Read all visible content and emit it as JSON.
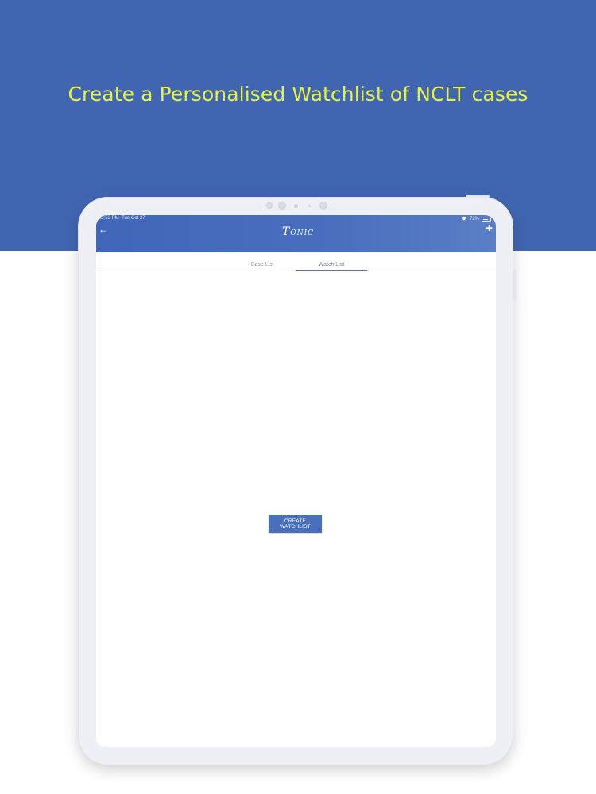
{
  "headline": "Create a Personalised Watchlist of NCLT cases",
  "status_bar": {
    "time": "12:52 PM",
    "date": "Tue Oct 27",
    "battery": "72%"
  },
  "app_bar": {
    "logo_initial": "T",
    "logo_rest": "ONIC",
    "back_icon": "arrow-left-icon",
    "add_icon": "plus-icon"
  },
  "tabs": [
    {
      "label": "Case List",
      "selected": false
    },
    {
      "label": "Watch List",
      "selected": true
    }
  ],
  "create_button_label": "CREATE WATCHLIST",
  "colors": {
    "banner": "#4166b1",
    "headline": "#e8f04a",
    "app_bar": "#3f66b8",
    "button": "#4a70bd"
  }
}
